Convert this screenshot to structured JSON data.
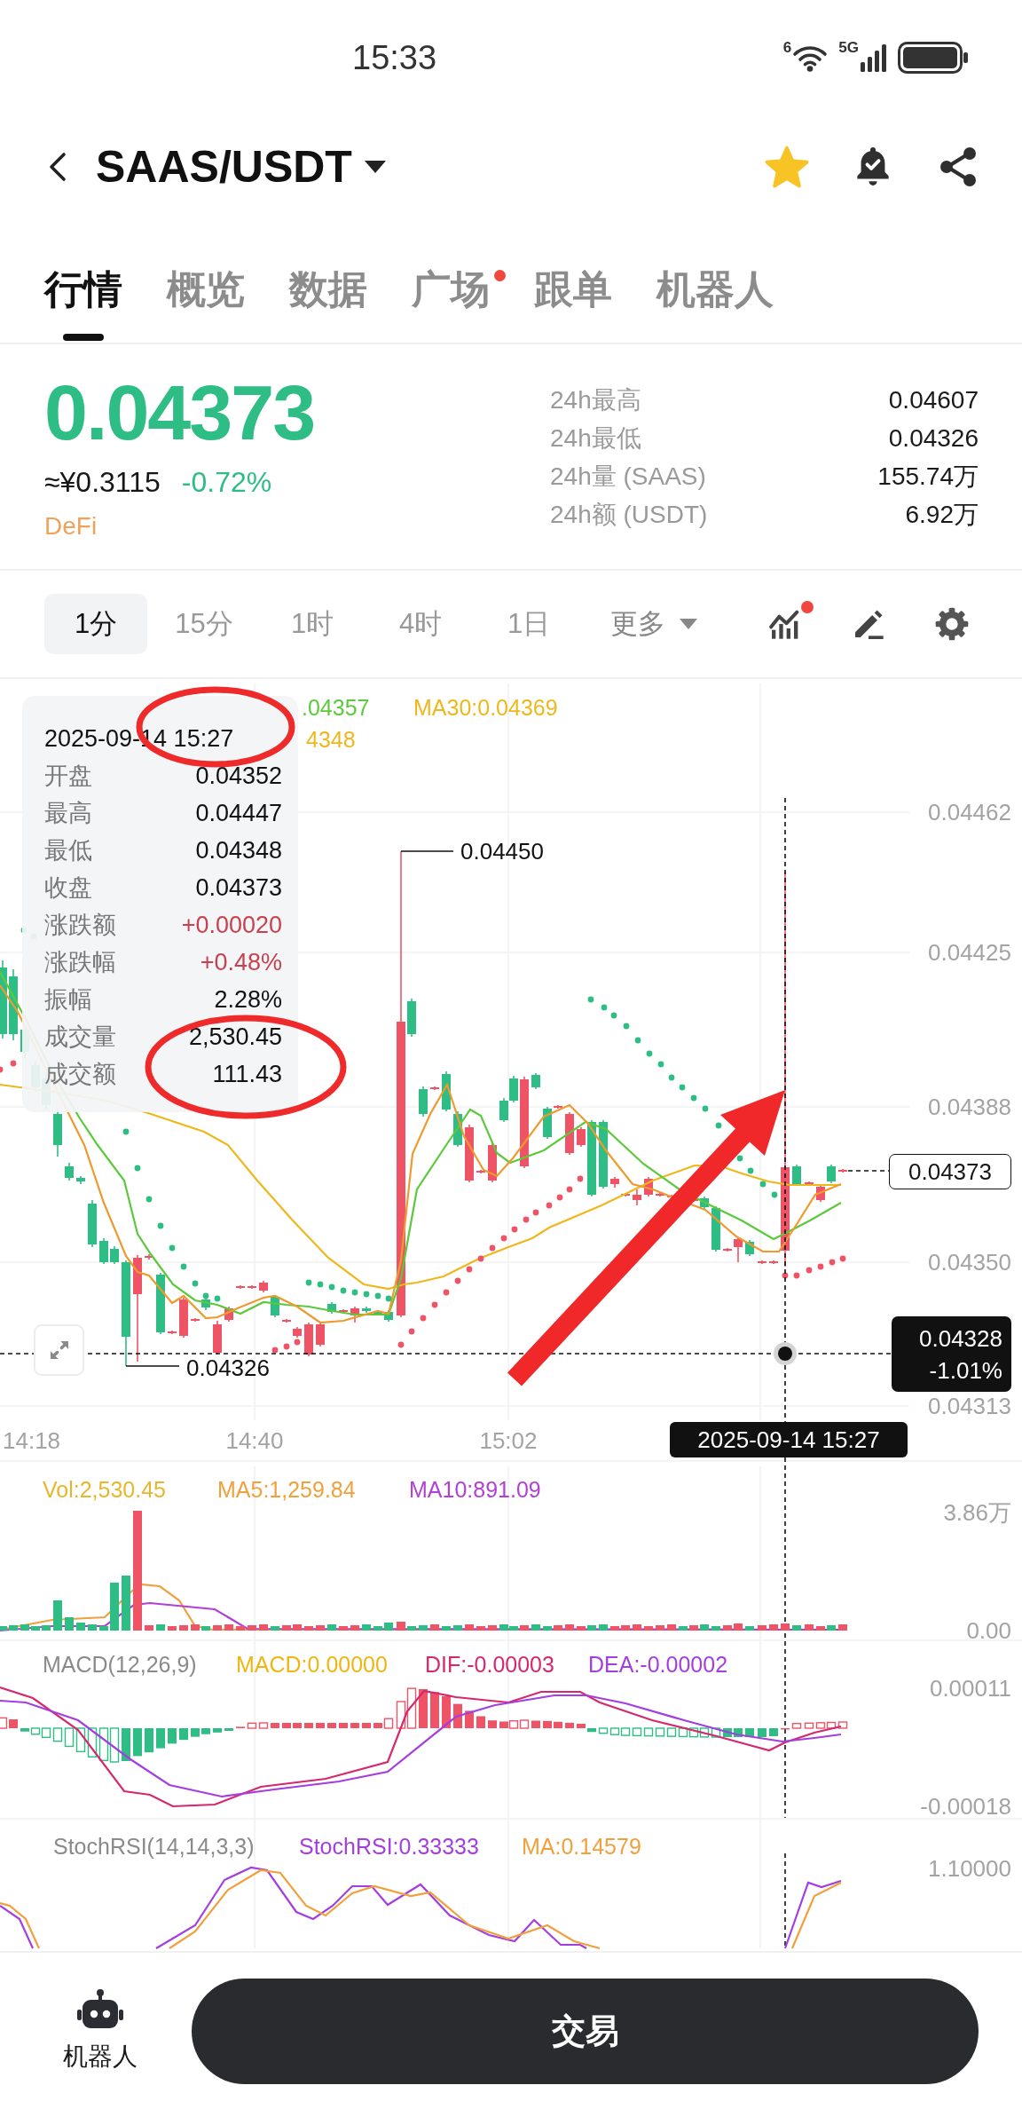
{
  "status_bar": {
    "time": "15:33",
    "wifi_tag": "6",
    "network": "5G"
  },
  "header": {
    "title": "SAAS/USDT",
    "favorite": true
  },
  "tabs": [
    {
      "label": "行情",
      "selected": true,
      "dot": false
    },
    {
      "label": "概览",
      "selected": false,
      "dot": false
    },
    {
      "label": "数据",
      "selected": false,
      "dot": false
    },
    {
      "label": "广场",
      "selected": false,
      "dot": true
    },
    {
      "label": "跟单",
      "selected": false,
      "dot": false
    },
    {
      "label": "机器人",
      "selected": false,
      "dot": false
    }
  ],
  "ticker": {
    "price": "0.04373",
    "rising": false,
    "fiat": "≈¥0.3115",
    "change": "-0.72%",
    "tag": "DeFi",
    "stats": [
      {
        "label": "24h最高",
        "value": "0.04607"
      },
      {
        "label": "24h最低",
        "value": "0.04326"
      },
      {
        "label": "24h量 (SAAS)",
        "value": "155.74万"
      },
      {
        "label": "24h额 (USDT)",
        "value": "6.92万"
      }
    ]
  },
  "intervals": [
    {
      "label": "1分",
      "selected": true
    },
    {
      "label": "15分",
      "selected": false
    },
    {
      "label": "1时",
      "selected": false
    },
    {
      "label": "4时",
      "selected": false
    },
    {
      "label": "1日",
      "selected": false
    }
  ],
  "more_menu": {
    "label": "更多"
  },
  "tools": [
    {
      "kind": "indicators",
      "badge": true
    },
    {
      "kind": "draw",
      "badge": false
    },
    {
      "kind": "settings",
      "badge": false
    }
  ],
  "chart": {
    "legend": [
      [
        {
          "text": ".04357",
          "color": "#5cc93c"
        },
        {
          "text": "MA30:0.04369",
          "color": "#eeb81c"
        }
      ],
      [
        {
          "text": "4348",
          "color": "#eeb81c"
        }
      ]
    ],
    "price_axis": [
      "0.04462",
      "0.04425",
      "0.04388",
      "0.04350",
      "0.04313"
    ],
    "time_axis": [
      "14:18",
      "14:40",
      "15:02"
    ],
    "high_label": "0.04450",
    "low_label": "0.04326",
    "last_price": "0.04373",
    "crosshair": {
      "price": "0.04328",
      "change": "-1.01%",
      "time": "2025-09-14 15:27"
    },
    "tooltip": {
      "time": "2025-09-14 15:27",
      "rows": [
        {
          "label": "开盘",
          "value": "0.04352",
          "highlight": false
        },
        {
          "label": "最高",
          "value": "0.04447",
          "highlight": false
        },
        {
          "label": "最低",
          "value": "0.04348",
          "highlight": false
        },
        {
          "label": "收盘",
          "value": "0.04373",
          "highlight": false
        },
        {
          "label": "涨跌额",
          "value": "+0.00020",
          "highlight": true
        },
        {
          "label": "涨跌幅",
          "value": "+0.48%",
          "highlight": true
        },
        {
          "label": "振幅",
          "value": "2.28%",
          "highlight": false
        },
        {
          "label": "成交量",
          "value": "2,530.45",
          "highlight": false
        },
        {
          "label": "成交额",
          "value": "111.43",
          "highlight": false
        }
      ]
    }
  },
  "volume": {
    "legend": [
      {
        "text": "Vol:2,530.45",
        "color": "#e8b62c"
      },
      {
        "text": "MA5:1,259.84",
        "color": "#f0a03c"
      },
      {
        "text": "MA10:891.09",
        "color": "#b23fd8"
      }
    ],
    "axis": [
      "3.86万",
      "0.00"
    ]
  },
  "macd": {
    "title": "MACD(12,26,9)",
    "legend": [
      {
        "text": "MACD:0.00000",
        "color": "#efb612"
      },
      {
        "text": "DIF:-0.00003",
        "color": "#d6286e"
      },
      {
        "text": "DEA:-0.00002",
        "color": "#a43ee0"
      }
    ],
    "axis": [
      "0.00011",
      "-0.00018"
    ]
  },
  "stoch_rsi": {
    "title": "StochRSI(14,14,3,3)",
    "legend": [
      {
        "text": "StochRSI:0.33333",
        "color": "#a43ee0"
      },
      {
        "text": "MA:0.14579",
        "color": "#f0a03c"
      }
    ],
    "axis": [
      "1.10000"
    ]
  },
  "annotations": [
    {
      "kind": "ellipse"
    },
    {
      "kind": "ellipse"
    },
    {
      "kind": "arrow"
    }
  ],
  "bottom_bar": {
    "nav_label": "机器人",
    "action": "交易"
  }
}
